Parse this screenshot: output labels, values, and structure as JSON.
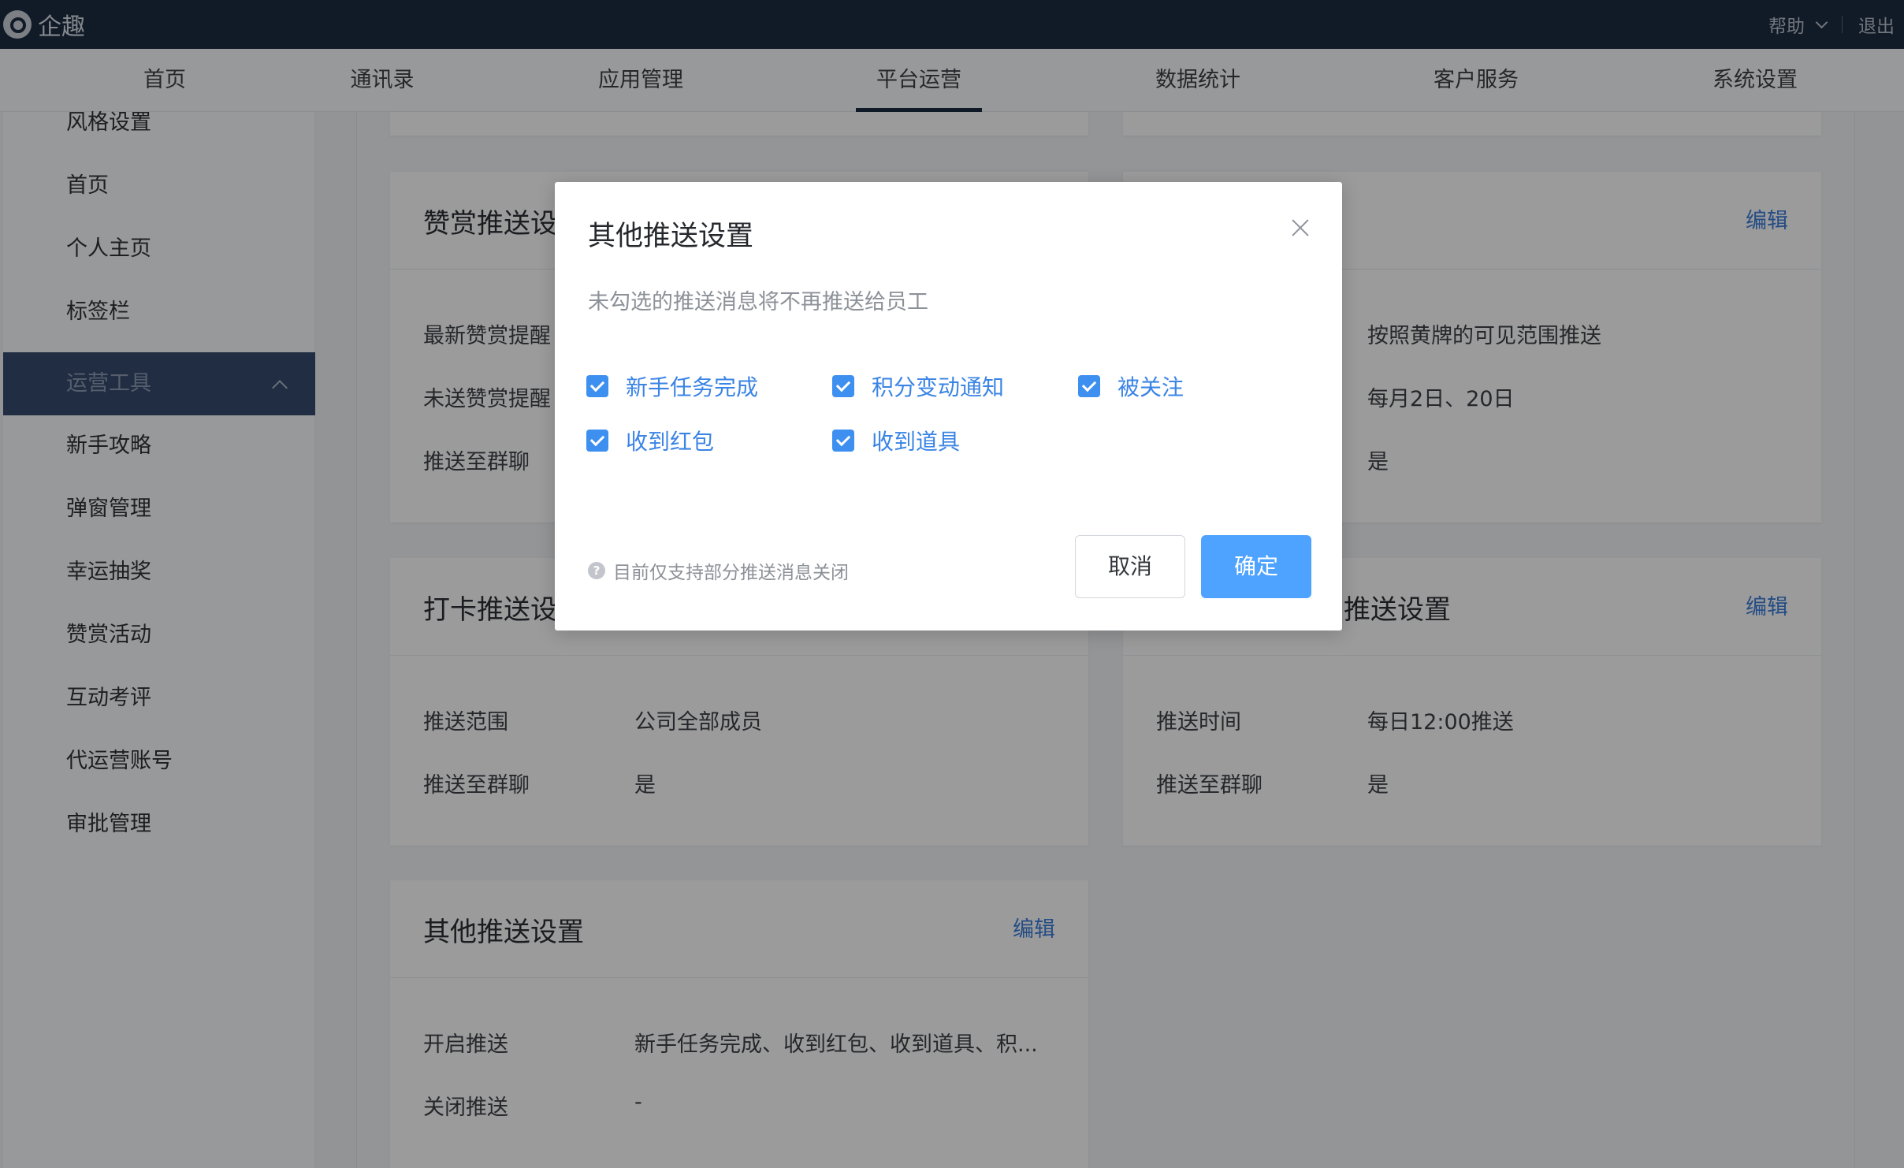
{
  "app": {
    "logo_text": "企趣"
  },
  "topbar": {
    "help": "帮助",
    "logout": "退出"
  },
  "nav": [
    "首页",
    "通讯录",
    "应用管理",
    "平台运营",
    "数据统计",
    "客户服务",
    "系统设置"
  ],
  "nav_active": "平台运营",
  "sidebar": {
    "items_top": [
      "风格设置",
      "首页",
      "个人主页",
      "标签栏"
    ],
    "group": "运营工具",
    "items": [
      "新手攻略",
      "弹窗管理",
      "幸运抽奖",
      "赞赏活动",
      "互动考评",
      "代运营账号",
      "审批管理"
    ]
  },
  "cards": {
    "reward": {
      "title": "赞赏推送设",
      "rows": [
        {
          "label": "最新赞赏提醒"
        },
        {
          "label": "未送赞赏提醒"
        },
        {
          "label": "推送至群聊"
        }
      ]
    },
    "right_top": {
      "edit": "编辑",
      "rows": [
        {
          "value": "按照黄牌的可见范围推送"
        },
        {
          "value": "每月2日、20日"
        },
        {
          "value": "是"
        }
      ]
    },
    "checkin": {
      "title": "打卡推送设",
      "rows": [
        {
          "label": "推送范围",
          "value": "公司全部成员"
        },
        {
          "label": "推送至群聊",
          "value": "是"
        }
      ]
    },
    "right_mid": {
      "title": "推送设置",
      "edit": "编辑",
      "rows": [
        {
          "label": "推送时间",
          "value": "每日12:00推送"
        },
        {
          "label": "推送至群聊",
          "value": "是"
        }
      ]
    },
    "other": {
      "title": "其他推送设置",
      "edit": "编辑",
      "rows": [
        {
          "label": "开启推送",
          "value": "新手任务完成、收到红包、收到道具、积..."
        },
        {
          "label": "关闭推送",
          "value": "-"
        }
      ]
    }
  },
  "modal": {
    "title": "其他推送设置",
    "description": "未勾选的推送消息将不再推送给员工",
    "options": [
      {
        "label": "新手任务完成",
        "checked": true
      },
      {
        "label": "积分变动通知",
        "checked": true
      },
      {
        "label": "被关注",
        "checked": true
      },
      {
        "label": "收到红包",
        "checked": true
      },
      {
        "label": "收到道具",
        "checked": true
      }
    ],
    "tip": "目前仅支持部分推送消息关闭",
    "cancel": "取消",
    "confirm": "确定"
  },
  "colors": {
    "topbar": "#1c2a40",
    "accent": "#4da3ff",
    "sidebar_active": "#34496b",
    "link": "#3a7bd5"
  }
}
